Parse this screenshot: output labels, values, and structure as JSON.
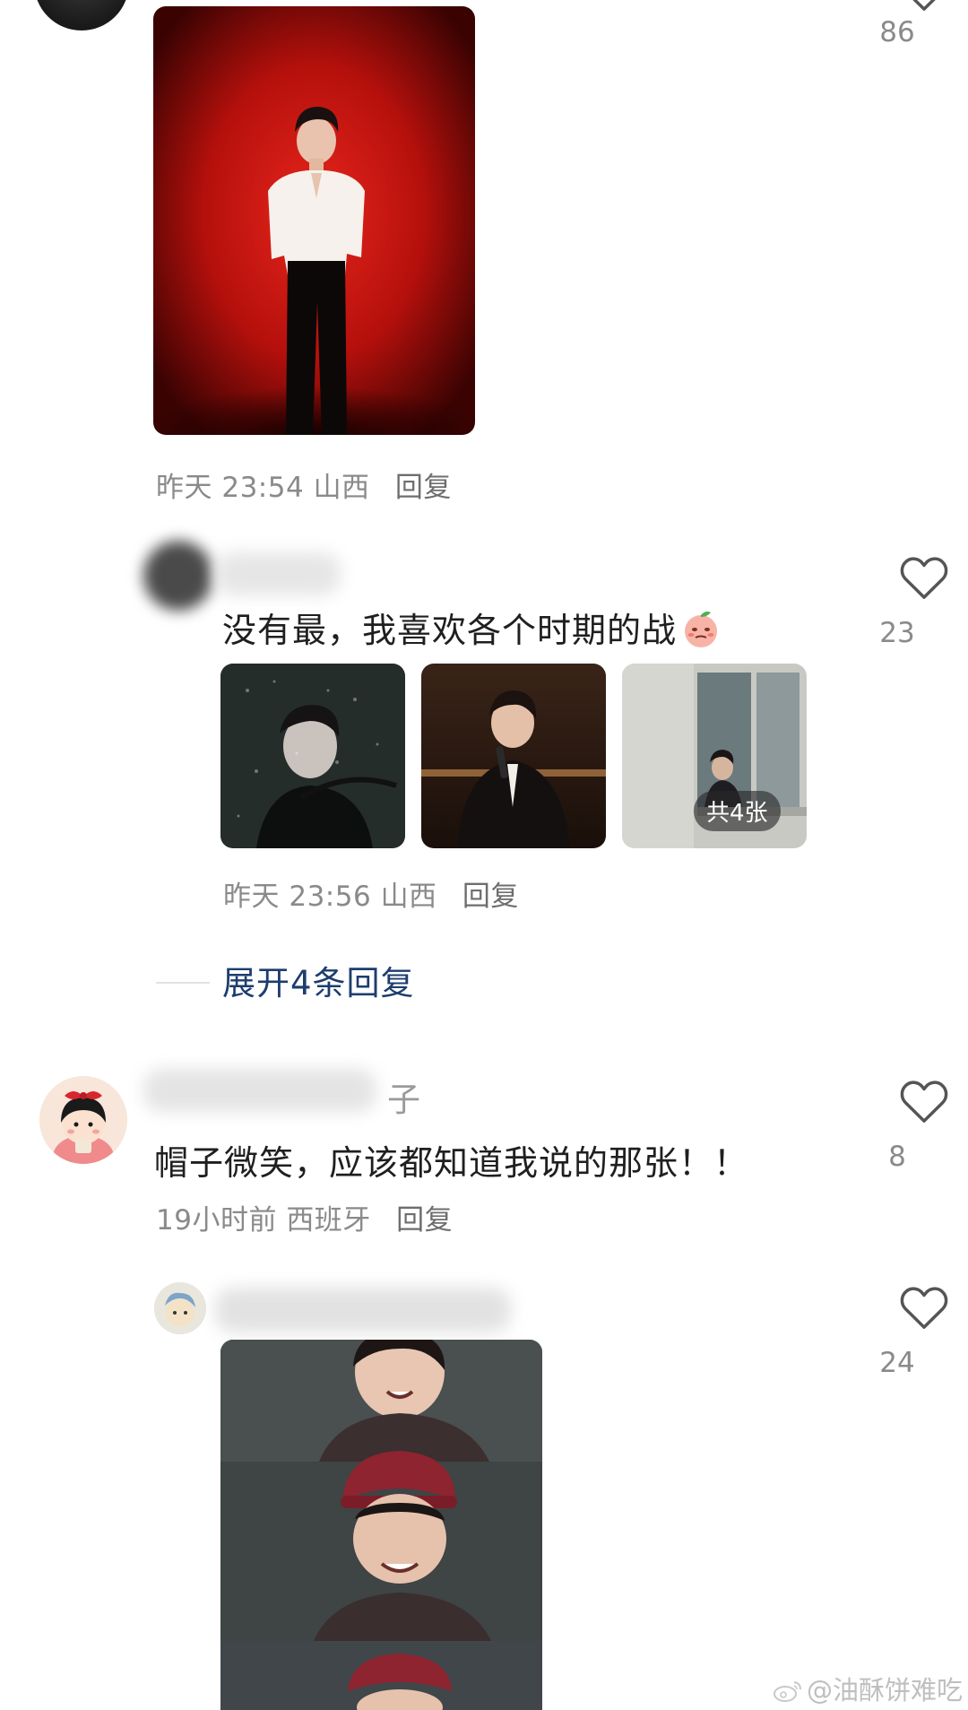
{
  "comments": [
    {
      "id": "c1",
      "time": "昨天 23:54",
      "location": "山西",
      "reply_label": "回复",
      "likes": "86"
    },
    {
      "id": "c2",
      "text": "没有最，我喜欢各个时期的战",
      "time": "昨天 23:56",
      "location": "山西",
      "reply_label": "回复",
      "likes": "23",
      "image_count_label": "共4张",
      "expand_label": "展开4条回复"
    },
    {
      "id": "c3",
      "username_visible_fragment": "子",
      "text": "帽子微笑，应该都知道我说的那张！！",
      "time": "19小时前",
      "location": "西班牙",
      "reply_label": "回复",
      "likes": "8"
    },
    {
      "id": "c4",
      "likes": "24"
    }
  ],
  "icons": {
    "like": "heart-outline-icon",
    "emoji": "peach-emoji-icon",
    "weibo": "weibo-logo-icon"
  },
  "colors": {
    "link_blue": "#1d3d6e",
    "meta_gray": "#8a8a8a",
    "text_dark": "#1f1f1f"
  },
  "watermark": {
    "text": "@油酥饼难吃"
  }
}
